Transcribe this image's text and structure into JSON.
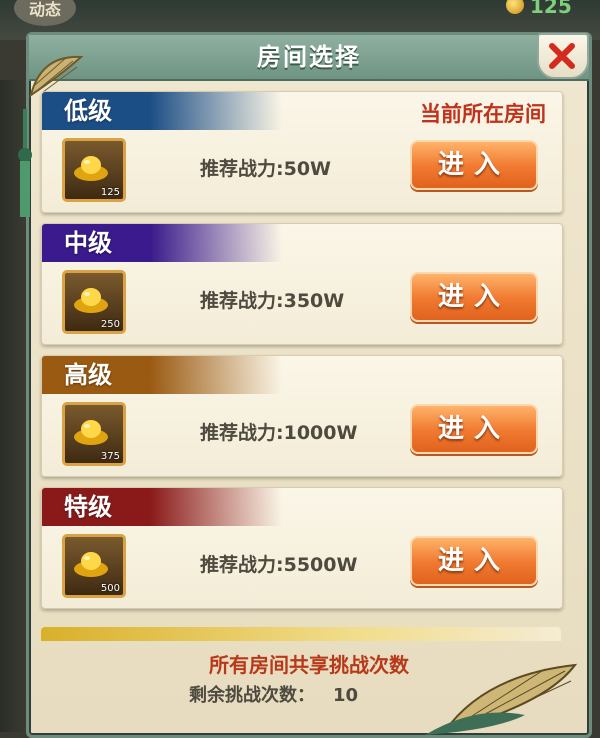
{
  "background": {
    "badge_text": "动态",
    "coin_value": "125"
  },
  "dialog": {
    "title": "房间选择"
  },
  "rooms": [
    {
      "title": "低级",
      "status": "当前所在房间",
      "item_count": "125",
      "power_label": "推荐战力:50W",
      "button": "进入",
      "color": "#1c4e86"
    },
    {
      "title": "中级",
      "status": "",
      "item_count": "250",
      "power_label": "推荐战力:350W",
      "button": "进入",
      "color": "#3a1a8c"
    },
    {
      "title": "高级",
      "status": "",
      "item_count": "375",
      "power_label": "推荐战力:1000W",
      "button": "进入",
      "color": "#9a5a12"
    },
    {
      "title": "特级",
      "status": "",
      "item_count": "500",
      "power_label": "推荐战力:5500W",
      "button": "进入",
      "color": "#8a1a1a"
    }
  ],
  "footer": {
    "shared_note": "所有房间共享挑战次数",
    "remaining_label": "剩余挑战次数：",
    "remaining_value": "10"
  },
  "icons": {
    "close": "close-icon",
    "item": "gold-ingot-icon"
  }
}
